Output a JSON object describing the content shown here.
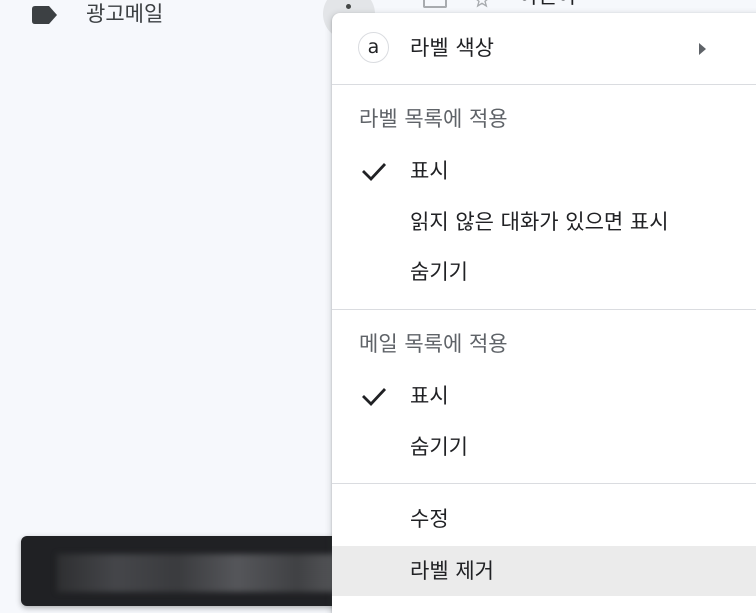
{
  "sidebar": {
    "label_name": "광고메일",
    "label_icon": "label-tag-icon"
  },
  "background_row": {
    "sender": "이런이",
    "checkbox_icon": "checkbox-icon",
    "star_icon": "star-icon"
  },
  "more_button": {
    "icon": "more-vert-icon"
  },
  "menu": {
    "label_color": {
      "label": "라벨 색상",
      "swatch_letter": "a",
      "arrow_icon": "submenu-arrow-icon"
    },
    "label_list_section": {
      "header": "라벨 목록에 적용",
      "items": [
        {
          "label": "표시",
          "checked": true
        },
        {
          "label": "읽지 않은 대화가 있으면 표시",
          "checked": false
        },
        {
          "label": "숨기기",
          "checked": false
        }
      ]
    },
    "message_list_section": {
      "header": "메일 목록에 적용",
      "items": [
        {
          "label": "표시",
          "checked": true
        },
        {
          "label": "숨기기",
          "checked": false
        }
      ]
    },
    "actions": {
      "edit": "수정",
      "remove_label": "라벨 제거"
    }
  },
  "colors": {
    "page_background": "#f6f8fc",
    "menu_background": "#ffffff",
    "highlight": "#ebebeb",
    "snackbar": "#202124"
  }
}
